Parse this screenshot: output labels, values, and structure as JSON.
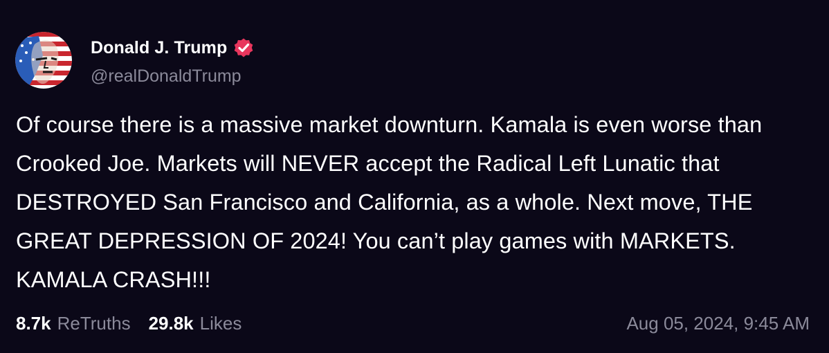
{
  "author": {
    "display_name": "Donald J. Trump",
    "handle": "@realDonaldTrump",
    "verified": true,
    "verified_color": "#e8365d"
  },
  "post": {
    "text": "Of course there is a massive market downturn. Kamala is even worse than Crooked Joe. Markets will NEVER accept the Radical Left Lunatic that DESTROYED San Francisco and California, as a whole. Next move, THE GREAT DEPRESSION OF 2024! You can’t play games with MARKETS. KAMALA CRASH!!!",
    "timestamp": "Aug 05, 2024, 9:45 AM"
  },
  "stats": {
    "retruths_count": "8.7k",
    "retruths_label": "ReTruths",
    "likes_count": "29.8k",
    "likes_label": "Likes"
  },
  "colors": {
    "background": "#0b0818",
    "text": "#ffffff",
    "muted": "#8b8a9a"
  }
}
